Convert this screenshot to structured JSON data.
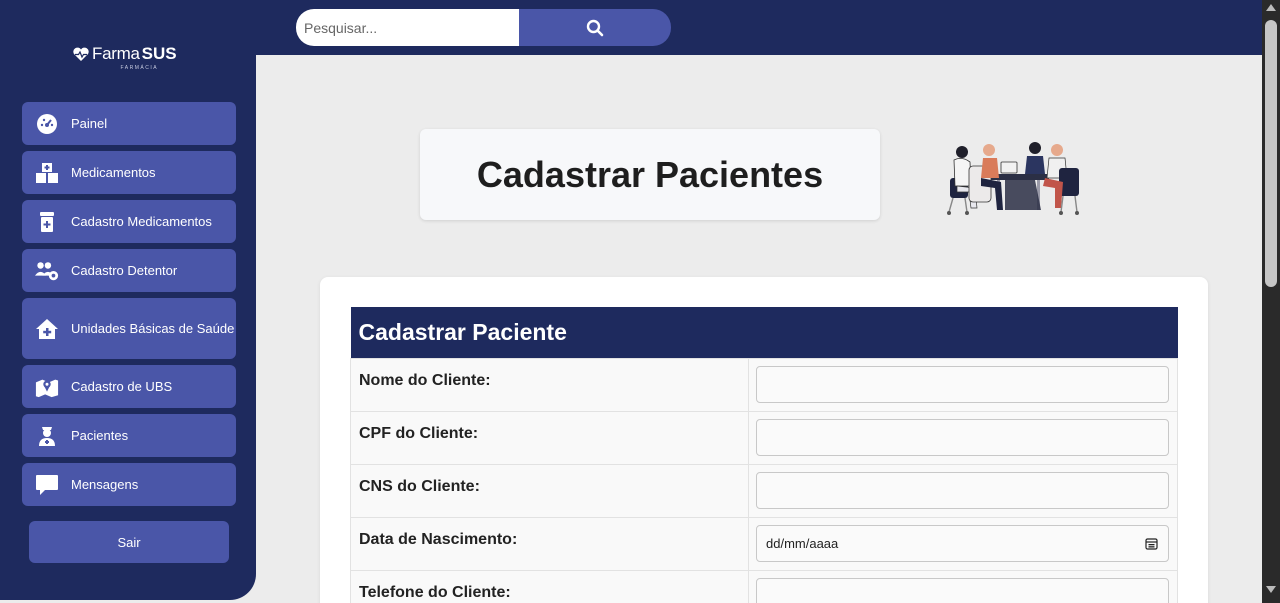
{
  "search": {
    "placeholder": "Pesquisar...",
    "icon": "search-icon"
  },
  "logo": {
    "farma": "Farma",
    "sus": "SUS",
    "sub": "FARMÁCIA"
  },
  "sidebar": {
    "items": [
      {
        "label": "Painel",
        "icon": "dashboard-gauge-icon"
      },
      {
        "label": "Medicamentos",
        "icon": "medicine-boxes-icon"
      },
      {
        "label": "Cadastro Medicamentos",
        "icon": "prescription-bottle-icon"
      },
      {
        "label": "Cadastro Detentor",
        "icon": "users-cog-icon"
      },
      {
        "label": "Unidades Básicas de Saúde",
        "icon": "house-medical-icon"
      },
      {
        "label": "Cadastro de UBS",
        "icon": "map-location-icon"
      },
      {
        "label": "Pacientes",
        "icon": "user-nurse-icon"
      },
      {
        "label": "Mensagens",
        "icon": "message-icon"
      }
    ],
    "logout_label": "Sair"
  },
  "page": {
    "title": "Cadastrar Pacientes"
  },
  "form": {
    "header": "Cadastrar Paciente",
    "fields": [
      {
        "label": "Nome do Cliente:",
        "value": ""
      },
      {
        "label": "CPF do Cliente:",
        "value": ""
      },
      {
        "label": "CNS do Cliente:",
        "value": ""
      },
      {
        "label": "Data de Nascimento:",
        "value": "dd/mm/aaaa"
      },
      {
        "label": "Telefone do Cliente:",
        "value": ""
      }
    ]
  },
  "colors": {
    "navy": "#1e2a5e",
    "accent": "#4a56a8",
    "background": "#ececec"
  }
}
